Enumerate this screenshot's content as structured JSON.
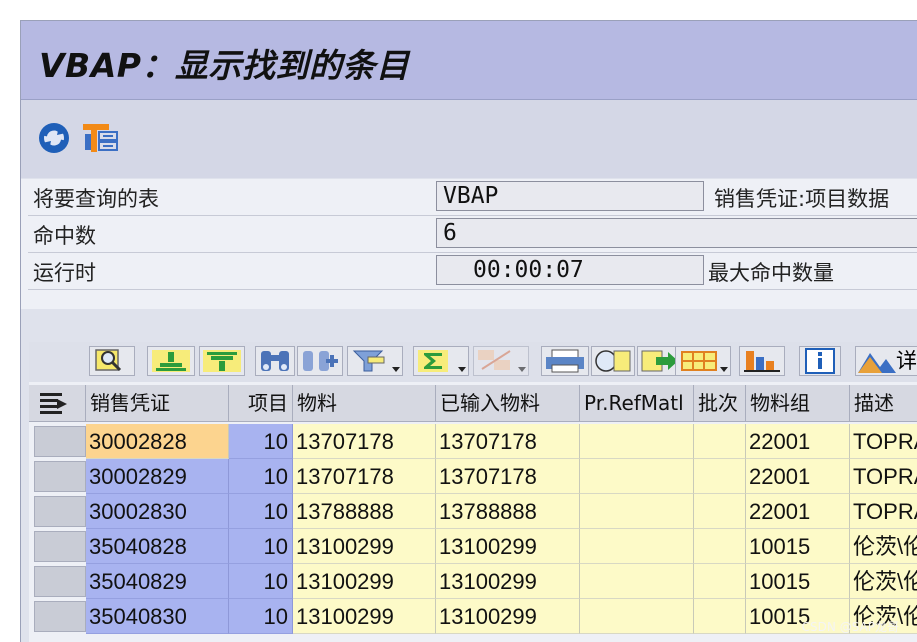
{
  "window": {
    "title": "VBAP：显示找到的条目"
  },
  "toolbar": {
    "buttons": [
      {
        "icon": "refresh-icon"
      },
      {
        "icon": "selection-criteria-icon"
      }
    ]
  },
  "fields": [
    {
      "label": "将要查询的表",
      "value": "VBAP",
      "description": "销售凭证:项目数据"
    },
    {
      "label": "命中数",
      "value": "6"
    },
    {
      "label": "运行时",
      "value": "00:00:07",
      "description": "最大命中数量"
    }
  ],
  "alv_toolbar": {
    "details_label": "详"
  },
  "table": {
    "columns": [
      "销售凭证",
      "项目",
      "物料",
      "已输入物料",
      "Pr.RefMatl",
      "批次",
      "物料组",
      "描述"
    ],
    "rows": [
      [
        "30002828",
        "10",
        "13707178",
        "13707178",
        "",
        "",
        "22001",
        "TOPRA"
      ],
      [
        "30002829",
        "10",
        "13707178",
        "13707178",
        "",
        "",
        "22001",
        "TOPRA"
      ],
      [
        "30002830",
        "10",
        "13788888",
        "13788888",
        "",
        "",
        "22001",
        "TOPRA"
      ],
      [
        "35040828",
        "10",
        "13100299",
        "13100299",
        "",
        "",
        "10015",
        "伦茨\\伦"
      ],
      [
        "35040829",
        "10",
        "13100299",
        "13100299",
        "",
        "",
        "10015",
        "伦茨\\伦"
      ],
      [
        "35040830",
        "10",
        "13100299",
        "13100299",
        "",
        "",
        "10015",
        "伦茨\\伦"
      ]
    ]
  },
  "watermark": "CSDN @SAP龙哥",
  "colors": {
    "title_bar": "#b6b9e2",
    "key_column": "#a8b3f0",
    "data_cells": "#fdfac8",
    "current_cell": "#fcd48f"
  }
}
